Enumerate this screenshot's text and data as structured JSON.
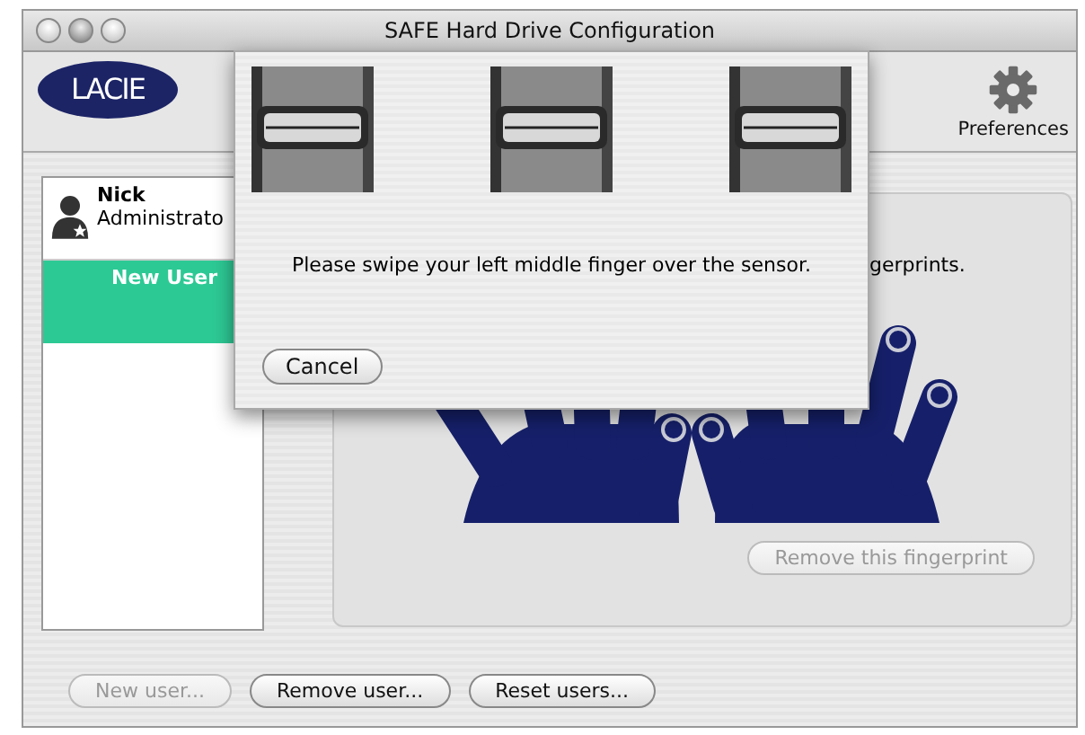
{
  "window": {
    "title": "SAFE Hard Drive Configuration"
  },
  "toolbar": {
    "logo": "LACIE",
    "preferences": "Preferences"
  },
  "users": [
    {
      "name": "Nick",
      "role": "Administrato",
      "kind": "admin",
      "selected": false
    },
    {
      "name": "New User",
      "kind": "new",
      "selected": true
    }
  ],
  "panel": {
    "instruction": "gerprints.",
    "remove_button": {
      "label": "Remove this fingerprint",
      "disabled": true
    }
  },
  "buttons": [
    {
      "label": "New user...",
      "disabled": true
    },
    {
      "label": "Remove user...",
      "disabled": false
    },
    {
      "label": "Reset users...",
      "disabled": false
    }
  ],
  "sheet": {
    "message": "Please swipe your left middle finger over the sensor.",
    "cancel": "Cancel"
  }
}
